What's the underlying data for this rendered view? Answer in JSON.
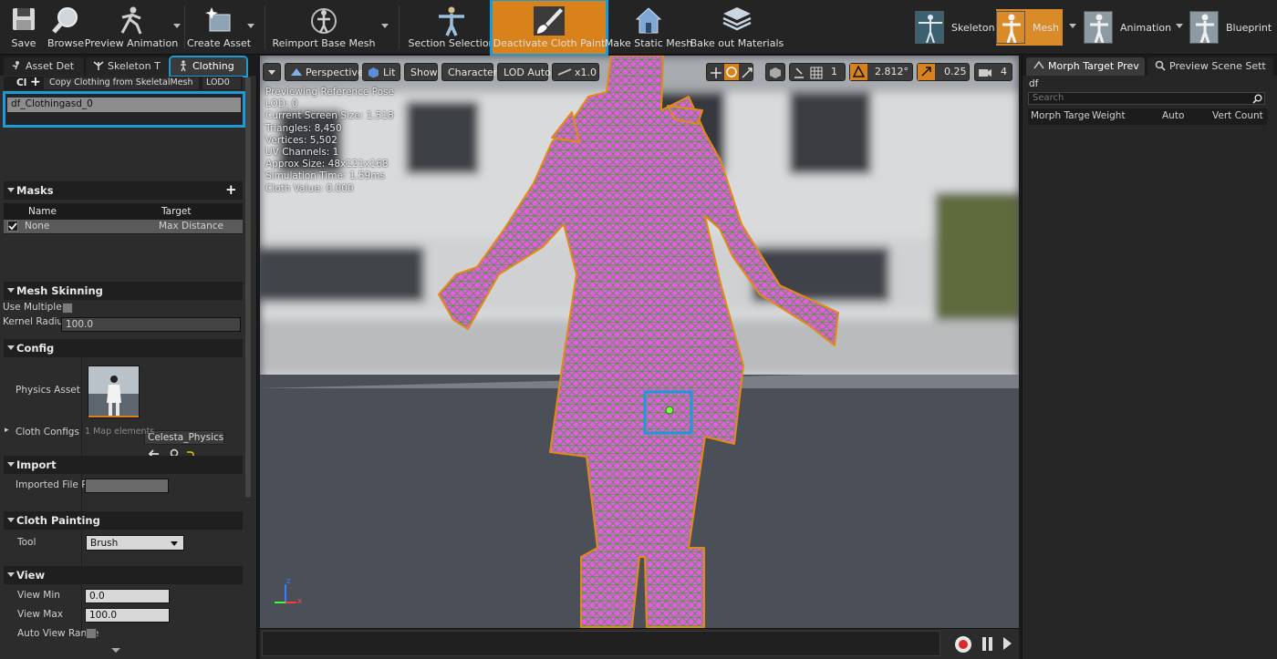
{
  "toolbar": {
    "save": "Save",
    "browse": "Browse",
    "preview_animation": "Preview Animation",
    "create_asset": "Create Asset",
    "reimport_base_mesh": "Reimport Base Mesh",
    "section_selection": "Section Selection",
    "deactivate_cloth_paint": "Deactivate Cloth Paint",
    "make_static_mesh": "Make Static Mesh",
    "bake_out_materials": "Bake out Materials"
  },
  "modes": {
    "skeleton": "Skeleton",
    "mesh": "Mesh",
    "animation": "Animation",
    "blueprint": "Blueprint"
  },
  "left_tabs": {
    "asset_details": "Asset Det",
    "skeleton_tree": "Skeleton T",
    "clothing": "Clothing"
  },
  "clothing": {
    "header_short": "Cl",
    "copy_clothing": "Copy Clothing from SkeletalMesh",
    "lod": "LOD0",
    "asset_name": "df_Clothingasd_0"
  },
  "masks": {
    "title": "Masks",
    "col_name": "Name",
    "col_target": "Target",
    "rows": [
      {
        "name": "None",
        "target": "Max Distance",
        "checked": true
      }
    ]
  },
  "mesh_skinning": {
    "title": "Mesh Skinning",
    "use_multiple": "Use Multiple",
    "kernel_radius_label": "Kernel Radius",
    "kernel_radius_value": "100.0"
  },
  "config": {
    "title": "Config",
    "physics_asset_label": "Physics Asset",
    "physics_asset_value": "Celesta_Physics",
    "cloth_configs_label": "Cloth Configs",
    "cloth_configs_value": "1 Map elements"
  },
  "import": {
    "title": "Import",
    "imported_file_label": "Imported File Pa"
  },
  "cloth_painting": {
    "title": "Cloth Painting",
    "tool_label": "Tool",
    "tool_value": "Brush"
  },
  "view": {
    "title": "View",
    "view_min_label": "View Min",
    "view_min_value": "0.0",
    "view_max_label": "View Max",
    "view_max_value": "100.0",
    "auto_view_range_label": "Auto View Range"
  },
  "viewport": {
    "perspective": "Perspective",
    "lit": "Lit",
    "show": "Show",
    "character": "Character",
    "lod_auto": "LOD Auto",
    "speed": "x1.0",
    "grid_value": "1",
    "angle_value": "2.812°",
    "scale_value": "0.25",
    "camera_speed": "4",
    "info_lines": [
      "Previewing Reference Pose",
      "LOD: 0",
      "Current Screen Size: 1.518",
      "Triangles: 8,450",
      "Vertices: 5,502",
      "UV Channels: 1",
      "Approx Size: 48x121x168",
      "Simulation Time: 1.59ms",
      "Cloth Value: 0.000"
    ],
    "axis_z": "z",
    "axis_x": "x"
  },
  "right_panel": {
    "tab_morph": "Morph Target Prev",
    "tab_preview_scene": "Preview Scene Sett",
    "filter_text": "df",
    "search_placeholder": "Search",
    "col_morph_target": "Morph Targe",
    "col_weight": "Weight",
    "col_auto": "Auto",
    "col_vert_count": "Vert Count"
  },
  "colors": {
    "accent_orange": "#d9821c",
    "highlight_blue": "#1a9bd7",
    "cloth_magenta": "#e35ce3",
    "wire_green": "#4f9a3c"
  }
}
